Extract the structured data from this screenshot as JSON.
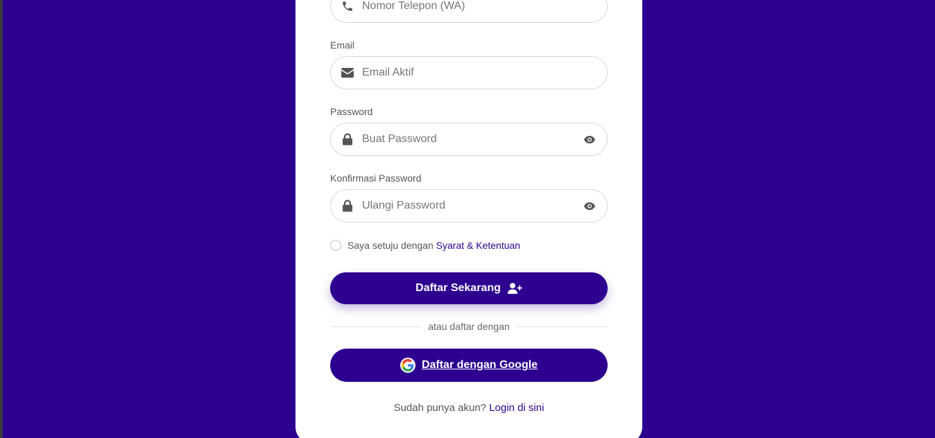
{
  "colors": {
    "background": "#2d008f",
    "card": "#ffffff",
    "accent": "#2d008f",
    "label": "#555555"
  },
  "form": {
    "phone": {
      "placeholder": "Nomor Telepon (WA)",
      "icon": "phone-icon"
    },
    "email": {
      "label": "Email",
      "placeholder": "Email Aktif",
      "icon": "envelope-icon"
    },
    "password": {
      "label": "Password",
      "placeholder": "Buat Password",
      "icon": "lock-icon",
      "toggle_icon": "eye-icon"
    },
    "confirm_password": {
      "label": "Konfirmasi Password",
      "placeholder": "Ulangi Password",
      "icon": "lock-icon",
      "toggle_icon": "eye-icon"
    },
    "terms": {
      "text": "Saya setuju dengan",
      "link": "Syarat & Ketentuan",
      "checked": false
    },
    "submit_label": "Daftar Sekarang",
    "submit_icon": "user-plus-icon",
    "divider_text": "atau daftar dengan",
    "google_label": "Daftar dengan Google",
    "google_icon": "google-icon"
  },
  "footer": {
    "text": "Sudah punya akun?",
    "link": "Login di sini"
  }
}
